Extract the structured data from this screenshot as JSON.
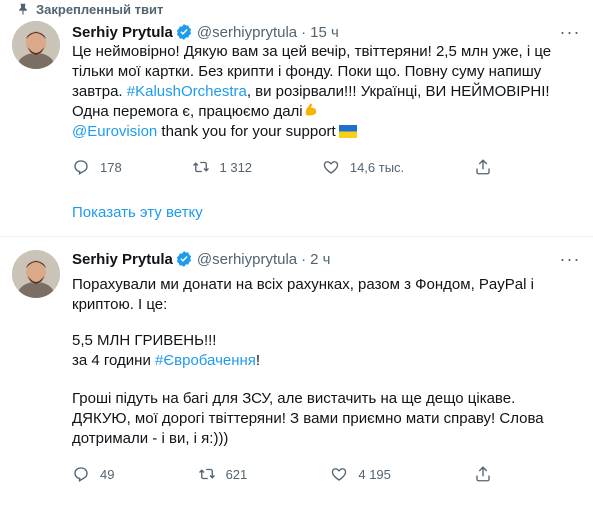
{
  "tweet1": {
    "pinned_label": "Закрепленный твит",
    "name": "Serhiy Prytula",
    "handle": "@serhiyprytula",
    "time": "15 ч",
    "lines": [
      "Це неймовірно! Дякую вам за цей вечір, твіттеряни! 2,5 млн уже, і це",
      "тільки мої картки. Без крипти і фонду. Поки що. Повну суму напишу",
      "завтра.",
      "#KalushOrchestra",
      ", ви розірвали!!! Українці, ВИ НЕЙМОВІРНІ!",
      "Одна перемога є, працюємо далі",
      "@Eurovision",
      " thank you for your support"
    ],
    "stats": {
      "replies": "178",
      "retweets": "1 312",
      "likes": "14,6 тыс."
    },
    "show_thread": "Показать эту ветку"
  },
  "tweet2": {
    "name": "Serhiy Prytula",
    "handle": "@serhiyprytula",
    "time": "2 ч",
    "lines": [
      "Порахували ми донати на всіх рахунках, разом з Фондом, PayPal і",
      "криптою. І це:",
      "5,5 МЛН ГРИВЕНЬ!!!",
      "за 4 години",
      "#Євробачення",
      "!",
      "Гроші підуть на багі для ЗСУ, але вистачить на ще дещо цікаве.",
      "ДЯКУЮ, мої дорогі твіттеряни! З вами приємно мати справу! Слова",
      "дотримали - і ви, і я:)))"
    ],
    "stats": {
      "replies": "49",
      "retweets": "621",
      "likes": "4 195"
    }
  },
  "colors": {
    "accent": "#1d9bf0",
    "secondary": "#536471",
    "text": "#0f1419"
  },
  "icons": [
    "pin-icon",
    "verified-icon",
    "more-icon",
    "reply-icon",
    "retweet-icon",
    "like-icon",
    "share-icon",
    "flag-ua-icon",
    "flexed-biceps-icon"
  ]
}
